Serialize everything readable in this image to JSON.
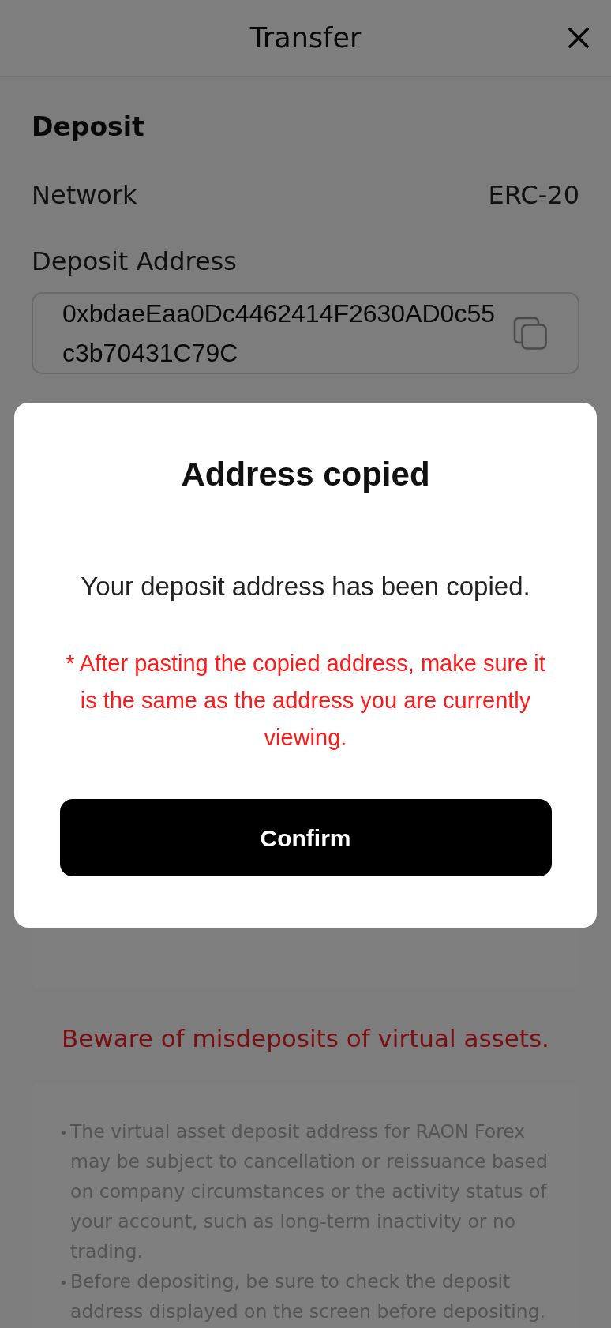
{
  "header": {
    "title": "Transfer"
  },
  "deposit": {
    "heading": "Deposit",
    "network_label": "Network",
    "network_value": "ERC-20",
    "address_label": "Deposit Address",
    "address": "0xbdaeEaa0Dc4462414F2630AD0c55c3b70431C79C"
  },
  "warning": {
    "title": "Beware of misdeposits of virtual assets."
  },
  "notices": [
    "The virtual asset deposit address for RAON Forex may be subject to cancellation or reissuance based on company circumstances or the activity status of your account, such as long-term inactivity or no trading.",
    "Before depositing, be sure to check the deposit address displayed on the screen before depositing."
  ],
  "dialog": {
    "title": "Address copied",
    "message": "Your deposit address has been copied.",
    "note": "* After pasting the copied address, make sure it is the same as the address you are currently viewing.",
    "button": "Confirm"
  }
}
